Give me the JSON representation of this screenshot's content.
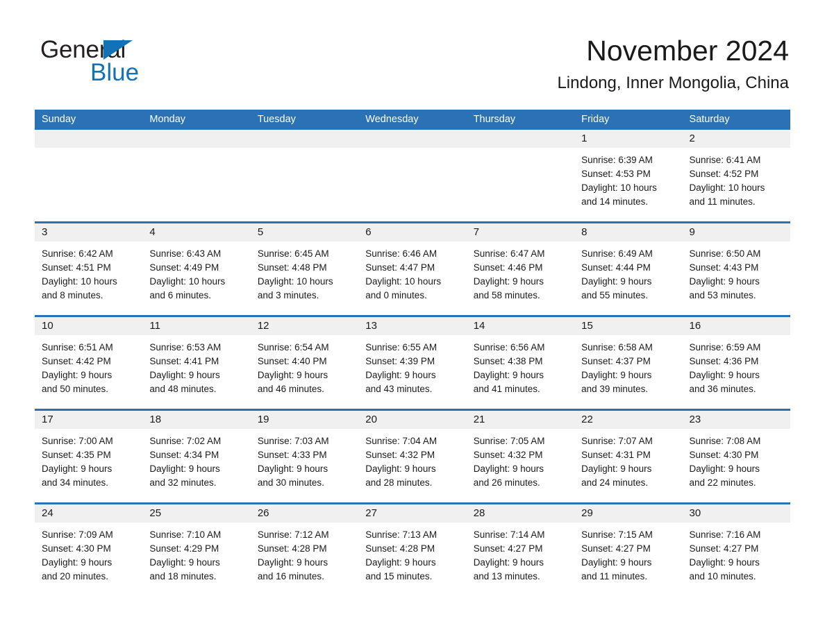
{
  "brand": {
    "word1": "General",
    "word2": "Blue",
    "triangle_color": "#1272b8"
  },
  "header": {
    "month_title": "November 2024",
    "location": "Lindong, Inner Mongolia, China"
  },
  "theme": {
    "header_blue": "#2a72b5",
    "day_band_gray": "#f0f0f0",
    "text": "#1a1a1a"
  },
  "weekdays": [
    "Sunday",
    "Monday",
    "Tuesday",
    "Wednesday",
    "Thursday",
    "Friday",
    "Saturday"
  ],
  "weeks": [
    [
      {
        "day": "",
        "lines": []
      },
      {
        "day": "",
        "lines": []
      },
      {
        "day": "",
        "lines": []
      },
      {
        "day": "",
        "lines": []
      },
      {
        "day": "",
        "lines": []
      },
      {
        "day": "1",
        "lines": [
          "Sunrise: 6:39 AM",
          "Sunset: 4:53 PM",
          "Daylight: 10 hours",
          "and 14 minutes."
        ]
      },
      {
        "day": "2",
        "lines": [
          "Sunrise: 6:41 AM",
          "Sunset: 4:52 PM",
          "Daylight: 10 hours",
          "and 11 minutes."
        ]
      }
    ],
    [
      {
        "day": "3",
        "lines": [
          "Sunrise: 6:42 AM",
          "Sunset: 4:51 PM",
          "Daylight: 10 hours",
          "and 8 minutes."
        ]
      },
      {
        "day": "4",
        "lines": [
          "Sunrise: 6:43 AM",
          "Sunset: 4:49 PM",
          "Daylight: 10 hours",
          "and 6 minutes."
        ]
      },
      {
        "day": "5",
        "lines": [
          "Sunrise: 6:45 AM",
          "Sunset: 4:48 PM",
          "Daylight: 10 hours",
          "and 3 minutes."
        ]
      },
      {
        "day": "6",
        "lines": [
          "Sunrise: 6:46 AM",
          "Sunset: 4:47 PM",
          "Daylight: 10 hours",
          "and 0 minutes."
        ]
      },
      {
        "day": "7",
        "lines": [
          "Sunrise: 6:47 AM",
          "Sunset: 4:46 PM",
          "Daylight: 9 hours",
          "and 58 minutes."
        ]
      },
      {
        "day": "8",
        "lines": [
          "Sunrise: 6:49 AM",
          "Sunset: 4:44 PM",
          "Daylight: 9 hours",
          "and 55 minutes."
        ]
      },
      {
        "day": "9",
        "lines": [
          "Sunrise: 6:50 AM",
          "Sunset: 4:43 PM",
          "Daylight: 9 hours",
          "and 53 minutes."
        ]
      }
    ],
    [
      {
        "day": "10",
        "lines": [
          "Sunrise: 6:51 AM",
          "Sunset: 4:42 PM",
          "Daylight: 9 hours",
          "and 50 minutes."
        ]
      },
      {
        "day": "11",
        "lines": [
          "Sunrise: 6:53 AM",
          "Sunset: 4:41 PM",
          "Daylight: 9 hours",
          "and 48 minutes."
        ]
      },
      {
        "day": "12",
        "lines": [
          "Sunrise: 6:54 AM",
          "Sunset: 4:40 PM",
          "Daylight: 9 hours",
          "and 46 minutes."
        ]
      },
      {
        "day": "13",
        "lines": [
          "Sunrise: 6:55 AM",
          "Sunset: 4:39 PM",
          "Daylight: 9 hours",
          "and 43 minutes."
        ]
      },
      {
        "day": "14",
        "lines": [
          "Sunrise: 6:56 AM",
          "Sunset: 4:38 PM",
          "Daylight: 9 hours",
          "and 41 minutes."
        ]
      },
      {
        "day": "15",
        "lines": [
          "Sunrise: 6:58 AM",
          "Sunset: 4:37 PM",
          "Daylight: 9 hours",
          "and 39 minutes."
        ]
      },
      {
        "day": "16",
        "lines": [
          "Sunrise: 6:59 AM",
          "Sunset: 4:36 PM",
          "Daylight: 9 hours",
          "and 36 minutes."
        ]
      }
    ],
    [
      {
        "day": "17",
        "lines": [
          "Sunrise: 7:00 AM",
          "Sunset: 4:35 PM",
          "Daylight: 9 hours",
          "and 34 minutes."
        ]
      },
      {
        "day": "18",
        "lines": [
          "Sunrise: 7:02 AM",
          "Sunset: 4:34 PM",
          "Daylight: 9 hours",
          "and 32 minutes."
        ]
      },
      {
        "day": "19",
        "lines": [
          "Sunrise: 7:03 AM",
          "Sunset: 4:33 PM",
          "Daylight: 9 hours",
          "and 30 minutes."
        ]
      },
      {
        "day": "20",
        "lines": [
          "Sunrise: 7:04 AM",
          "Sunset: 4:32 PM",
          "Daylight: 9 hours",
          "and 28 minutes."
        ]
      },
      {
        "day": "21",
        "lines": [
          "Sunrise: 7:05 AM",
          "Sunset: 4:32 PM",
          "Daylight: 9 hours",
          "and 26 minutes."
        ]
      },
      {
        "day": "22",
        "lines": [
          "Sunrise: 7:07 AM",
          "Sunset: 4:31 PM",
          "Daylight: 9 hours",
          "and 24 minutes."
        ]
      },
      {
        "day": "23",
        "lines": [
          "Sunrise: 7:08 AM",
          "Sunset: 4:30 PM",
          "Daylight: 9 hours",
          "and 22 minutes."
        ]
      }
    ],
    [
      {
        "day": "24",
        "lines": [
          "Sunrise: 7:09 AM",
          "Sunset: 4:30 PM",
          "Daylight: 9 hours",
          "and 20 minutes."
        ]
      },
      {
        "day": "25",
        "lines": [
          "Sunrise: 7:10 AM",
          "Sunset: 4:29 PM",
          "Daylight: 9 hours",
          "and 18 minutes."
        ]
      },
      {
        "day": "26",
        "lines": [
          "Sunrise: 7:12 AM",
          "Sunset: 4:28 PM",
          "Daylight: 9 hours",
          "and 16 minutes."
        ]
      },
      {
        "day": "27",
        "lines": [
          "Sunrise: 7:13 AM",
          "Sunset: 4:28 PM",
          "Daylight: 9 hours",
          "and 15 minutes."
        ]
      },
      {
        "day": "28",
        "lines": [
          "Sunrise: 7:14 AM",
          "Sunset: 4:27 PM",
          "Daylight: 9 hours",
          "and 13 minutes."
        ]
      },
      {
        "day": "29",
        "lines": [
          "Sunrise: 7:15 AM",
          "Sunset: 4:27 PM",
          "Daylight: 9 hours",
          "and 11 minutes."
        ]
      },
      {
        "day": "30",
        "lines": [
          "Sunrise: 7:16 AM",
          "Sunset: 4:27 PM",
          "Daylight: 9 hours",
          "and 10 minutes."
        ]
      }
    ]
  ]
}
